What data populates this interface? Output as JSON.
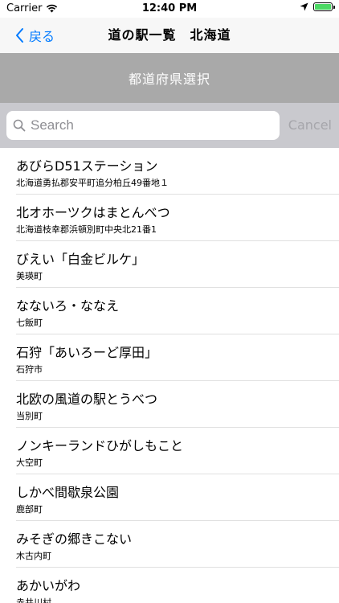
{
  "status_bar": {
    "carrier": "Carrier",
    "time": "12:40 PM"
  },
  "nav": {
    "back_label": "戻る",
    "title": "道の駅一覧　北海道"
  },
  "prefecture_button": "都道府県選択",
  "search": {
    "placeholder": "Search",
    "cancel_label": "Cancel"
  },
  "stations": [
    {
      "name": "あびらD51ステーション",
      "address": "北海道勇払郡安平町追分柏丘49番地１"
    },
    {
      "name": "北オホーツクはまとんべつ",
      "address": "北海道枝幸郡浜頓別町中央北21番1"
    },
    {
      "name": "びえい「白金ビルケ」",
      "address": "美瑛町"
    },
    {
      "name": "なないろ・ななえ",
      "address": "七飯町"
    },
    {
      "name": "石狩「あいろーど厚田」",
      "address": "石狩市"
    },
    {
      "name": "北欧の風道の駅とうべつ",
      "address": "当別町"
    },
    {
      "name": "ノンキーランドひがしもこと",
      "address": "大空町"
    },
    {
      "name": "しかべ間歇泉公園",
      "address": "鹿部町"
    },
    {
      "name": "みそぎの郷きこない",
      "address": "木古内町"
    },
    {
      "name": "あかいがわ",
      "address": "赤井川村"
    }
  ],
  "colors": {
    "accent": "#007aff",
    "pref_bar": "#a9a9a9",
    "search_bg": "#c9c9ce",
    "battery": "#4cd964"
  }
}
